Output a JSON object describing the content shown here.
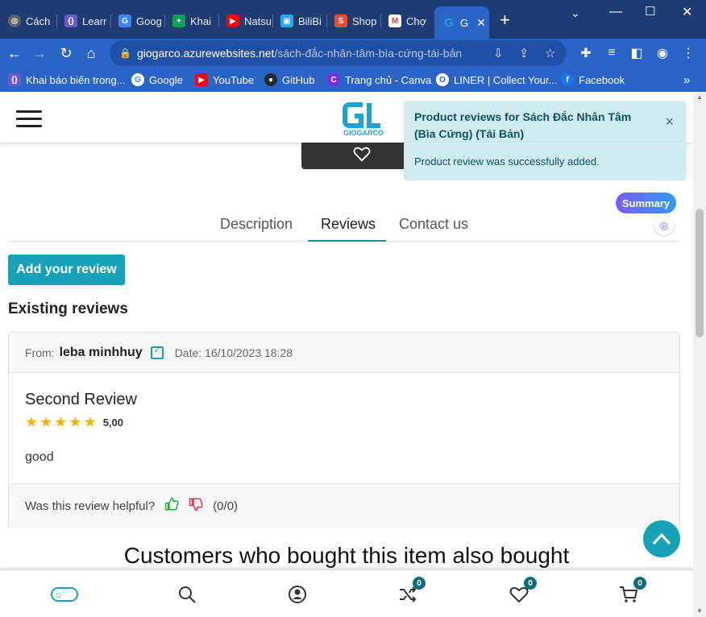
{
  "browser": {
    "tabs": [
      {
        "label": "Cách",
        "icon": "globe-icon",
        "color": "#5f6368"
      },
      {
        "label": "Learr",
        "icon": "code-icon",
        "color": "#6a5acd"
      },
      {
        "label": "Goog",
        "icon": "translate-icon",
        "color": "#4285f4"
      },
      {
        "label": "Khai",
        "icon": "sheets-plus-icon",
        "color": "#0f9d58"
      },
      {
        "label": "Natsu",
        "icon": "youtube-icon",
        "color": "#ff0000"
      },
      {
        "label": "BiliBi",
        "icon": "bilibili-icon",
        "color": "#23ade5"
      },
      {
        "label": "Shop",
        "icon": "shopee-icon",
        "color": "#ee4d2d"
      },
      {
        "label": "Chợ ",
        "icon": "gmail-icon",
        "color": "#ea4335"
      },
      {
        "label": "G",
        "icon": "giogarco-icon",
        "color": "#1aa3d6"
      }
    ],
    "active_tab_close": "✕",
    "new_tab": "+",
    "url_host": "giogarco.azurewebsites.net",
    "url_path": "/sách-đắc-nhân-tâm-bìa-cứng-tái-bản",
    "bookmarks": [
      {
        "label": "Khai báo biến trong...",
        "icon": "code-icon",
        "color": "#6a5acd"
      },
      {
        "label": "Google",
        "icon": "google-icon",
        "color": "#4285f4"
      },
      {
        "label": "YouTube",
        "icon": "youtube-icon",
        "color": "#ff0000"
      },
      {
        "label": "GitHub",
        "icon": "github-icon",
        "color": "#24292e"
      },
      {
        "label": "Trang chủ - Canva",
        "icon": "canva-icon",
        "color": "#7d2ae8"
      },
      {
        "label": "LINER | Collect Your...",
        "icon": "liner-icon",
        "color": "#2a64c6"
      },
      {
        "label": "Facebook",
        "icon": "facebook-icon",
        "color": "#1877f2"
      }
    ],
    "bookmarks_overflow": "»"
  },
  "toast": {
    "title": "Product reviews for Sách Đắc Nhân Tâm (Bìa Cứng) (Tái Bản)",
    "message": "Product review was successfully added.",
    "close": "×"
  },
  "summary": {
    "label": "Summary"
  },
  "product_tabs": {
    "description": "Description",
    "reviews": "Reviews",
    "contact": "Contact us"
  },
  "reviews": {
    "add_button": "Add your review",
    "existing_heading": "Existing reviews",
    "items": [
      {
        "from_label": "From:",
        "author": "leba minhhuy",
        "date_label": "Date: 16/10/2023 18:28",
        "title": "Second Review",
        "rating": 5,
        "rating_text": "5,00",
        "text": "good",
        "helpful_label": "Was this review helpful?",
        "helpful_count": "(0/0)"
      }
    ]
  },
  "also_bought": "Customers who bought this item also bought",
  "bottom_bar": {
    "compare_count": "0",
    "wishlist_count": "0",
    "cart_count": "0"
  }
}
